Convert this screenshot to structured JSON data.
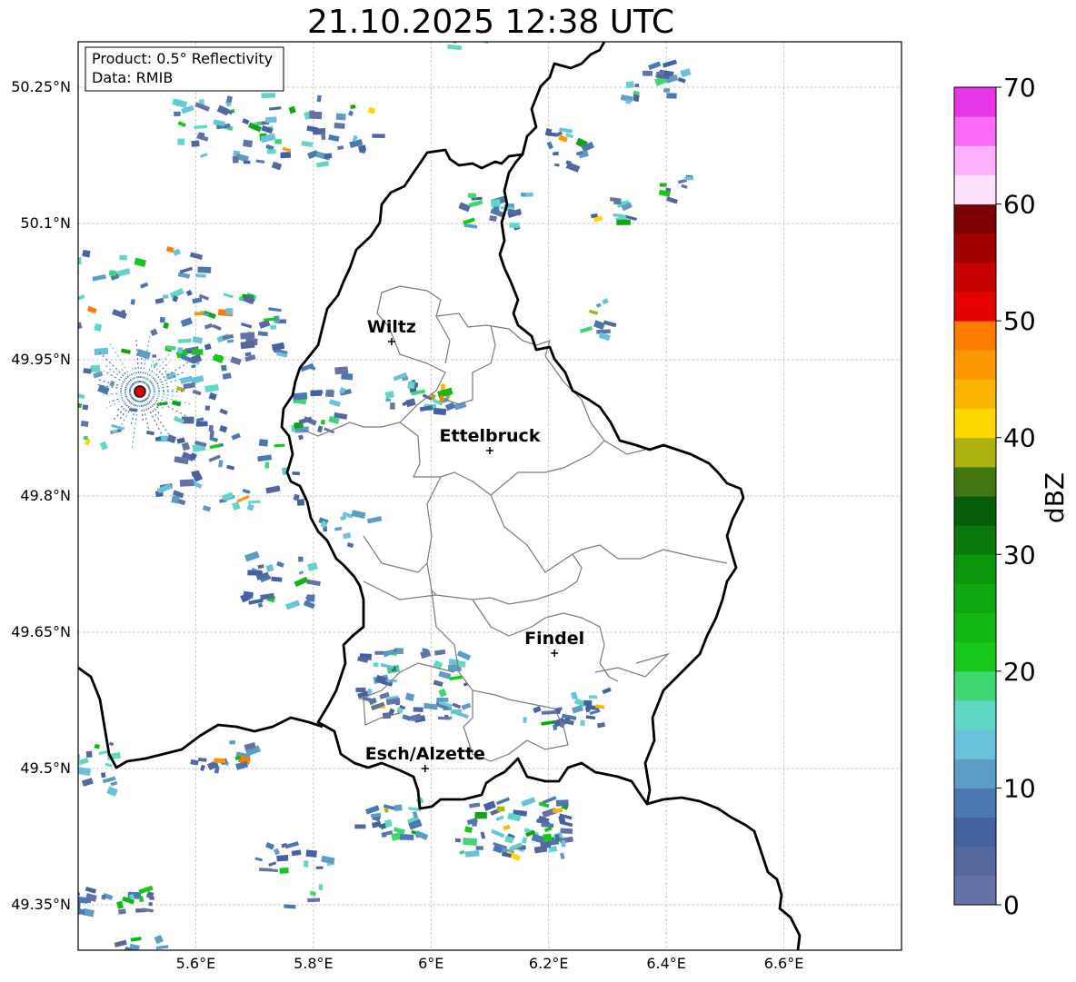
{
  "title": "21.10.2025 12:38 UTC",
  "info_box": {
    "product": "Product: 0.5° Reflectivity",
    "data_source": "Data: RMIB"
  },
  "map": {
    "lon_range": [
      5.4,
      6.8
    ],
    "lat_range": [
      49.3,
      50.3
    ],
    "lon_ticks": [
      {
        "value": 5.6,
        "label": "5.6°E"
      },
      {
        "value": 5.8,
        "label": "5.8°E"
      },
      {
        "value": 6.0,
        "label": "6°E"
      },
      {
        "value": 6.2,
        "label": "6.2°E"
      },
      {
        "value": 6.4,
        "label": "6.4°E"
      },
      {
        "value": 6.6,
        "label": "6.6°E"
      }
    ],
    "lat_ticks": [
      {
        "value": 49.35,
        "label": "49.35°N"
      },
      {
        "value": 49.5,
        "label": "49.5°N"
      },
      {
        "value": 49.65,
        "label": "49.65°N"
      },
      {
        "value": 49.8,
        "label": "49.8°N"
      },
      {
        "value": 49.95,
        "label": "49.95°N"
      },
      {
        "value": 50.1,
        "label": "50.1°N"
      },
      {
        "value": 50.25,
        "label": "50.25°N"
      }
    ],
    "grid": true,
    "cities": [
      {
        "name": "Wiltz",
        "lon": 5.933,
        "lat": 49.97
      },
      {
        "name": "Ettelbruck",
        "lon": 6.1,
        "lat": 49.85
      },
      {
        "name": "Findel",
        "lon": 6.21,
        "lat": 49.627
      },
      {
        "name": "Esch/Alzette",
        "lon": 5.99,
        "lat": 49.5
      }
    ],
    "radar_site": {
      "lon": 5.505,
      "lat": 49.915
    }
  },
  "colorbar": {
    "label": "dBZ",
    "min": 0,
    "max": 70,
    "step": 2.5,
    "ticks": [
      "0",
      "10",
      "20",
      "30",
      "40",
      "50",
      "60",
      "70"
    ],
    "colors": [
      "#6572a8",
      "#55689e",
      "#4461a2",
      "#4a78b0",
      "#5c9dc5",
      "#68c2da",
      "#5fd6c6",
      "#3fd673",
      "#17c71a",
      "#13b713",
      "#0fa70f",
      "#0b960b",
      "#0a790b",
      "#075d07",
      "#417612",
      "#adb30e",
      "#fed700",
      "#fdb505",
      "#fc9900",
      "#fd7d02",
      "#e20000",
      "#c40000",
      "#a00000",
      "#7c0000",
      "#fee1fd",
      "#feb2fd",
      "#fc6bfa",
      "#e935e8"
    ]
  }
}
